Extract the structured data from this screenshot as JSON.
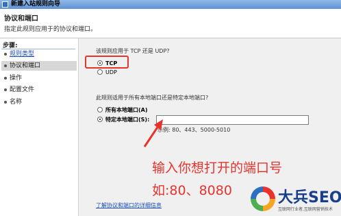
{
  "window": {
    "title": "新建入站规则向导"
  },
  "header": {
    "title": "协议和端口",
    "subtitle": "指定此规则应用于的协议和端口。"
  },
  "steps": {
    "title": "步骤:",
    "items": [
      {
        "label": "规则类型",
        "state": "link"
      },
      {
        "label": "协议和端口",
        "state": "active"
      },
      {
        "label": "操作",
        "state": "normal"
      },
      {
        "label": "配置文件",
        "state": "normal"
      },
      {
        "label": "名称",
        "state": "normal"
      }
    ]
  },
  "protocol": {
    "question": "该规则应用于 TCP 还是 UDP?",
    "options": [
      {
        "label": "TCP",
        "selected": true
      },
      {
        "label": "UDP",
        "selected": false
      }
    ]
  },
  "ports": {
    "question": "此规则适用于所有本地端口还是特定本地端口?",
    "options": [
      {
        "label": "所有本地端口(A)",
        "selected": false
      },
      {
        "label": "特定本地端口(S):",
        "selected": true
      }
    ],
    "value": "",
    "example": "示例: 80、443、5000-5010"
  },
  "annotation": {
    "line1": "输入你想打开的端口号",
    "line2": "如:80、8080"
  },
  "learn_more": "了解协议和端口的详细信息",
  "watermark": {
    "brand": "大兵SEO",
    "tagline": "互联网行业者,互联网营销技术"
  },
  "colors": {
    "annotation_red": "#e8332d",
    "link_blue": "#1a4fb8",
    "brand_blue": "#1a3f8a"
  }
}
